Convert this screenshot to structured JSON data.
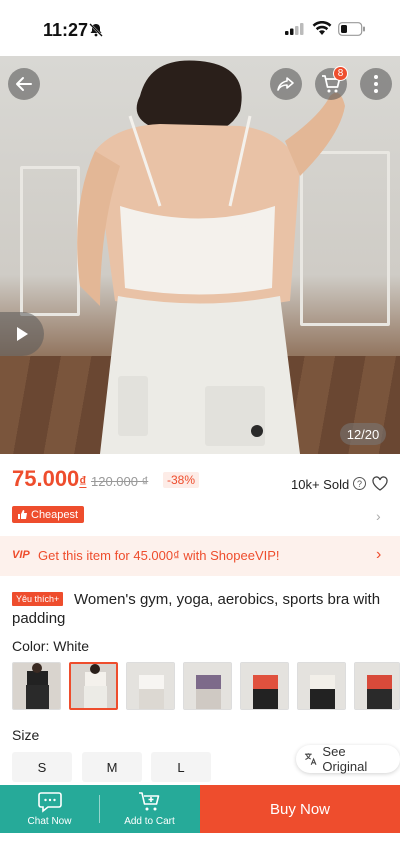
{
  "status_bar": {
    "time": "11:27"
  },
  "hero": {
    "image_counter": "12/20",
    "cart_count": "8"
  },
  "price": {
    "current": "75.000",
    "currency": "₫",
    "original": "120.000 ₫",
    "discount": "-38%",
    "sold": "10k+ Sold",
    "cheapest_label": "Cheapest"
  },
  "vip": {
    "text": "Get this item for 45.000₫ with ShopeeVIP!"
  },
  "product": {
    "badge": "Yêu thích+",
    "title": "Women's gym, yoga, aerobics, sports bra with padding"
  },
  "color": {
    "label": "Color: White",
    "selected_index": 1,
    "swatches": [
      "black",
      "white",
      "white",
      "purple",
      "red",
      "white",
      "red"
    ]
  },
  "size": {
    "label": "Size",
    "options": [
      "S",
      "M",
      "L"
    ]
  },
  "translate": {
    "label": "See Original"
  },
  "bottom_bar": {
    "chat": "Chat Now",
    "add_to_cart": "Add to Cart",
    "buy_now": "Buy Now"
  },
  "colors": {
    "accent": "#ee4d2d",
    "chat_bar": "#26aa99"
  },
  "icons": [
    "back-icon",
    "share-icon",
    "cart-icon",
    "more-icon",
    "play-icon",
    "heart-icon",
    "chat-icon",
    "add-cart-icon",
    "translate-icon"
  ]
}
